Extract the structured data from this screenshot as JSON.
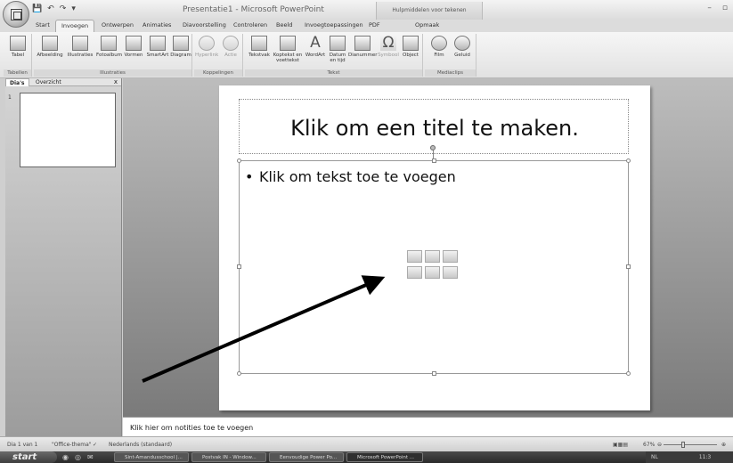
{
  "titlebar": {
    "app_title": "Presentatie1 - Microsoft PowerPoint",
    "context_title": "Hulpmiddelen voor tekenen",
    "qat": [
      "💾",
      "↶",
      "↷",
      "▾"
    ],
    "controls": [
      "–",
      "▫"
    ]
  },
  "tabs": [
    "Start",
    "Invoegen",
    "Ontwerpen",
    "Animaties",
    "Diavoorstelling",
    "Controleren",
    "Beeld",
    "Invoegtoepassingen",
    "PDF",
    "Opmaak"
  ],
  "ribbon": {
    "groups": {
      "tabellen": "Tabellen",
      "illustraties": "Illustraties",
      "koppelingen": "Koppelingen",
      "tekst": "Tekst",
      "mediaclips": "Mediaclips"
    },
    "buttons": {
      "tabel": "Tabel",
      "afbeelding": "Afbeelding",
      "illustraties": "Illustraties",
      "fotoalbum": "Fotoalbum",
      "vormen": "Vormen",
      "smartart": "SmartArt",
      "diagram": "Diagram",
      "hyperlink": "Hyperlink",
      "actie": "Actie",
      "tekstvak": "Tekstvak",
      "koptekst": "Koptekst en voettekst",
      "wordart": "WordArt",
      "datum": "Datum en tijd",
      "dianummer": "Dianummer",
      "symbool": "Symbool",
      "object": "Object",
      "film": "Film",
      "geluid": "Geluid"
    }
  },
  "left_panel": {
    "tab_slides": "Dia's",
    "tab_outline": "Overzicht",
    "close": "x",
    "slide_number": "1"
  },
  "slide": {
    "title_placeholder": "Klik om een titel te maken.",
    "bullet": "•",
    "content_placeholder": "Klik om tekst toe te voegen"
  },
  "notes": {
    "placeholder": "Klik hier om notities toe te voegen"
  },
  "statusbar": {
    "slide_count": "Dia 1 van 1",
    "theme": "\"Office-thema\"",
    "language": "Nederlands (standaard)",
    "zoom": "67%"
  },
  "taskbar": {
    "start": "start",
    "items": [
      "Sint-Amandusschool |...",
      "Postvak IN - Window...",
      "Eenvoudige Power Po...",
      "Microsoft PowerPoint ..."
    ],
    "tray_lang": "NL",
    "clock": "11:3"
  }
}
